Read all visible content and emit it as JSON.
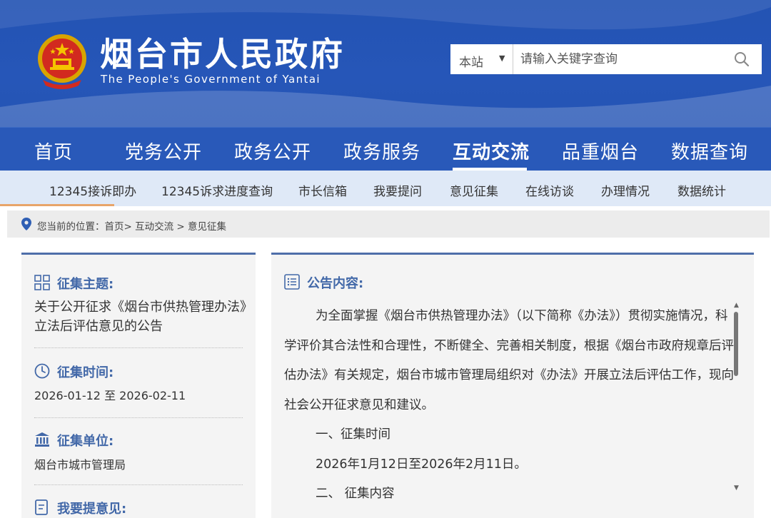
{
  "header": {
    "title": "烟台市人民政府",
    "subtitle": "The People's Government of Yantai"
  },
  "search": {
    "scope": "本站",
    "placeholder": "请输入关键字查询"
  },
  "nav": {
    "items": [
      "首页",
      "党务公开",
      "政务公开",
      "政务服务",
      "互动交流",
      "品重烟台",
      "数据查询"
    ],
    "active": "互动交流"
  },
  "subnav": {
    "items": [
      "12345接诉即办",
      "12345诉求进度查询",
      "市长信箱",
      "我要提问",
      "意见征集",
      "在线访谈",
      "办理情况",
      "数据统计"
    ]
  },
  "breadcrumb": {
    "text": "您当前的位置：首页> 互动交流 > 意见征集"
  },
  "left": {
    "topic_label": "征集主题:",
    "topic_value": "关于公开征求《烟台市供热管理办法》立法后评估意见的公告",
    "time_label": "征集时间:",
    "time_value": "2026-01-12 至 2026-02-11",
    "org_label": "征集单位:",
    "org_value": "烟台市城市管理局",
    "feedback_label": "我要提意见:"
  },
  "notice": {
    "label": "公告内容:",
    "para1": "为全面掌握《烟台市供热管理办法》（以下简称《办法》）贯彻实施情况，科学评价其合法性和合理性，不断健全、完善相关制度，根据《烟台市政府规章后评估办法》有关规定，烟台市城市管理局组织对《办法》开展立法后评估工作，现向社会公开征求意见和建议。",
    "section1": "一、征集时间",
    "period": "2026年1月12日至2026年2月11日。",
    "section2": "二、 征集内容"
  },
  "colors": {
    "header_bg": "#2353b3",
    "subnav_bg": "#dfe9f7",
    "accent_title": "#4268a8"
  }
}
